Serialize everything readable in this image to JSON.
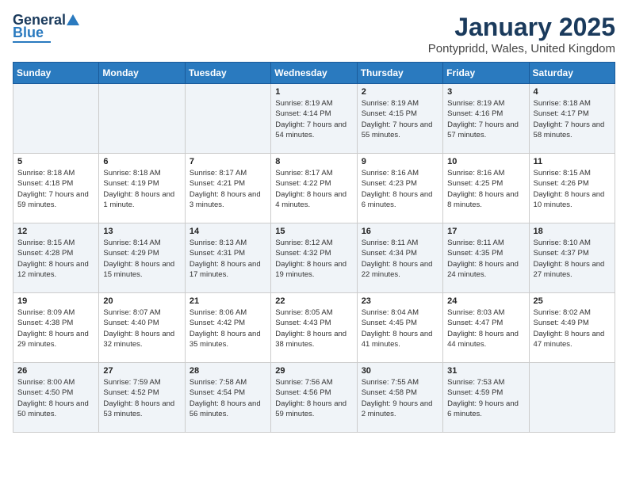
{
  "header": {
    "logo": {
      "line1": "General",
      "line2": "Blue"
    },
    "title": "January 2025",
    "location": "Pontypridd, Wales, United Kingdom"
  },
  "weekdays": [
    "Sunday",
    "Monday",
    "Tuesday",
    "Wednesday",
    "Thursday",
    "Friday",
    "Saturday"
  ],
  "weeks": [
    [
      {
        "day": "",
        "sunrise": "",
        "sunset": "",
        "daylight": ""
      },
      {
        "day": "",
        "sunrise": "",
        "sunset": "",
        "daylight": ""
      },
      {
        "day": "",
        "sunrise": "",
        "sunset": "",
        "daylight": ""
      },
      {
        "day": "1",
        "sunrise": "Sunrise: 8:19 AM",
        "sunset": "Sunset: 4:14 PM",
        "daylight": "Daylight: 7 hours and 54 minutes."
      },
      {
        "day": "2",
        "sunrise": "Sunrise: 8:19 AM",
        "sunset": "Sunset: 4:15 PM",
        "daylight": "Daylight: 7 hours and 55 minutes."
      },
      {
        "day": "3",
        "sunrise": "Sunrise: 8:19 AM",
        "sunset": "Sunset: 4:16 PM",
        "daylight": "Daylight: 7 hours and 57 minutes."
      },
      {
        "day": "4",
        "sunrise": "Sunrise: 8:18 AM",
        "sunset": "Sunset: 4:17 PM",
        "daylight": "Daylight: 7 hours and 58 minutes."
      }
    ],
    [
      {
        "day": "5",
        "sunrise": "Sunrise: 8:18 AM",
        "sunset": "Sunset: 4:18 PM",
        "daylight": "Daylight: 7 hours and 59 minutes."
      },
      {
        "day": "6",
        "sunrise": "Sunrise: 8:18 AM",
        "sunset": "Sunset: 4:19 PM",
        "daylight": "Daylight: 8 hours and 1 minute."
      },
      {
        "day": "7",
        "sunrise": "Sunrise: 8:17 AM",
        "sunset": "Sunset: 4:21 PM",
        "daylight": "Daylight: 8 hours and 3 minutes."
      },
      {
        "day": "8",
        "sunrise": "Sunrise: 8:17 AM",
        "sunset": "Sunset: 4:22 PM",
        "daylight": "Daylight: 8 hours and 4 minutes."
      },
      {
        "day": "9",
        "sunrise": "Sunrise: 8:16 AM",
        "sunset": "Sunset: 4:23 PM",
        "daylight": "Daylight: 8 hours and 6 minutes."
      },
      {
        "day": "10",
        "sunrise": "Sunrise: 8:16 AM",
        "sunset": "Sunset: 4:25 PM",
        "daylight": "Daylight: 8 hours and 8 minutes."
      },
      {
        "day": "11",
        "sunrise": "Sunrise: 8:15 AM",
        "sunset": "Sunset: 4:26 PM",
        "daylight": "Daylight: 8 hours and 10 minutes."
      }
    ],
    [
      {
        "day": "12",
        "sunrise": "Sunrise: 8:15 AM",
        "sunset": "Sunset: 4:28 PM",
        "daylight": "Daylight: 8 hours and 12 minutes."
      },
      {
        "day": "13",
        "sunrise": "Sunrise: 8:14 AM",
        "sunset": "Sunset: 4:29 PM",
        "daylight": "Daylight: 8 hours and 15 minutes."
      },
      {
        "day": "14",
        "sunrise": "Sunrise: 8:13 AM",
        "sunset": "Sunset: 4:31 PM",
        "daylight": "Daylight: 8 hours and 17 minutes."
      },
      {
        "day": "15",
        "sunrise": "Sunrise: 8:12 AM",
        "sunset": "Sunset: 4:32 PM",
        "daylight": "Daylight: 8 hours and 19 minutes."
      },
      {
        "day": "16",
        "sunrise": "Sunrise: 8:11 AM",
        "sunset": "Sunset: 4:34 PM",
        "daylight": "Daylight: 8 hours and 22 minutes."
      },
      {
        "day": "17",
        "sunrise": "Sunrise: 8:11 AM",
        "sunset": "Sunset: 4:35 PM",
        "daylight": "Daylight: 8 hours and 24 minutes."
      },
      {
        "day": "18",
        "sunrise": "Sunrise: 8:10 AM",
        "sunset": "Sunset: 4:37 PM",
        "daylight": "Daylight: 8 hours and 27 minutes."
      }
    ],
    [
      {
        "day": "19",
        "sunrise": "Sunrise: 8:09 AM",
        "sunset": "Sunset: 4:38 PM",
        "daylight": "Daylight: 8 hours and 29 minutes."
      },
      {
        "day": "20",
        "sunrise": "Sunrise: 8:07 AM",
        "sunset": "Sunset: 4:40 PM",
        "daylight": "Daylight: 8 hours and 32 minutes."
      },
      {
        "day": "21",
        "sunrise": "Sunrise: 8:06 AM",
        "sunset": "Sunset: 4:42 PM",
        "daylight": "Daylight: 8 hours and 35 minutes."
      },
      {
        "day": "22",
        "sunrise": "Sunrise: 8:05 AM",
        "sunset": "Sunset: 4:43 PM",
        "daylight": "Daylight: 8 hours and 38 minutes."
      },
      {
        "day": "23",
        "sunrise": "Sunrise: 8:04 AM",
        "sunset": "Sunset: 4:45 PM",
        "daylight": "Daylight: 8 hours and 41 minutes."
      },
      {
        "day": "24",
        "sunrise": "Sunrise: 8:03 AM",
        "sunset": "Sunset: 4:47 PM",
        "daylight": "Daylight: 8 hours and 44 minutes."
      },
      {
        "day": "25",
        "sunrise": "Sunrise: 8:02 AM",
        "sunset": "Sunset: 4:49 PM",
        "daylight": "Daylight: 8 hours and 47 minutes."
      }
    ],
    [
      {
        "day": "26",
        "sunrise": "Sunrise: 8:00 AM",
        "sunset": "Sunset: 4:50 PM",
        "daylight": "Daylight: 8 hours and 50 minutes."
      },
      {
        "day": "27",
        "sunrise": "Sunrise: 7:59 AM",
        "sunset": "Sunset: 4:52 PM",
        "daylight": "Daylight: 8 hours and 53 minutes."
      },
      {
        "day": "28",
        "sunrise": "Sunrise: 7:58 AM",
        "sunset": "Sunset: 4:54 PM",
        "daylight": "Daylight: 8 hours and 56 minutes."
      },
      {
        "day": "29",
        "sunrise": "Sunrise: 7:56 AM",
        "sunset": "Sunset: 4:56 PM",
        "daylight": "Daylight: 8 hours and 59 minutes."
      },
      {
        "day": "30",
        "sunrise": "Sunrise: 7:55 AM",
        "sunset": "Sunset: 4:58 PM",
        "daylight": "Daylight: 9 hours and 2 minutes."
      },
      {
        "day": "31",
        "sunrise": "Sunrise: 7:53 AM",
        "sunset": "Sunset: 4:59 PM",
        "daylight": "Daylight: 9 hours and 6 minutes."
      },
      {
        "day": "",
        "sunrise": "",
        "sunset": "",
        "daylight": ""
      }
    ]
  ]
}
